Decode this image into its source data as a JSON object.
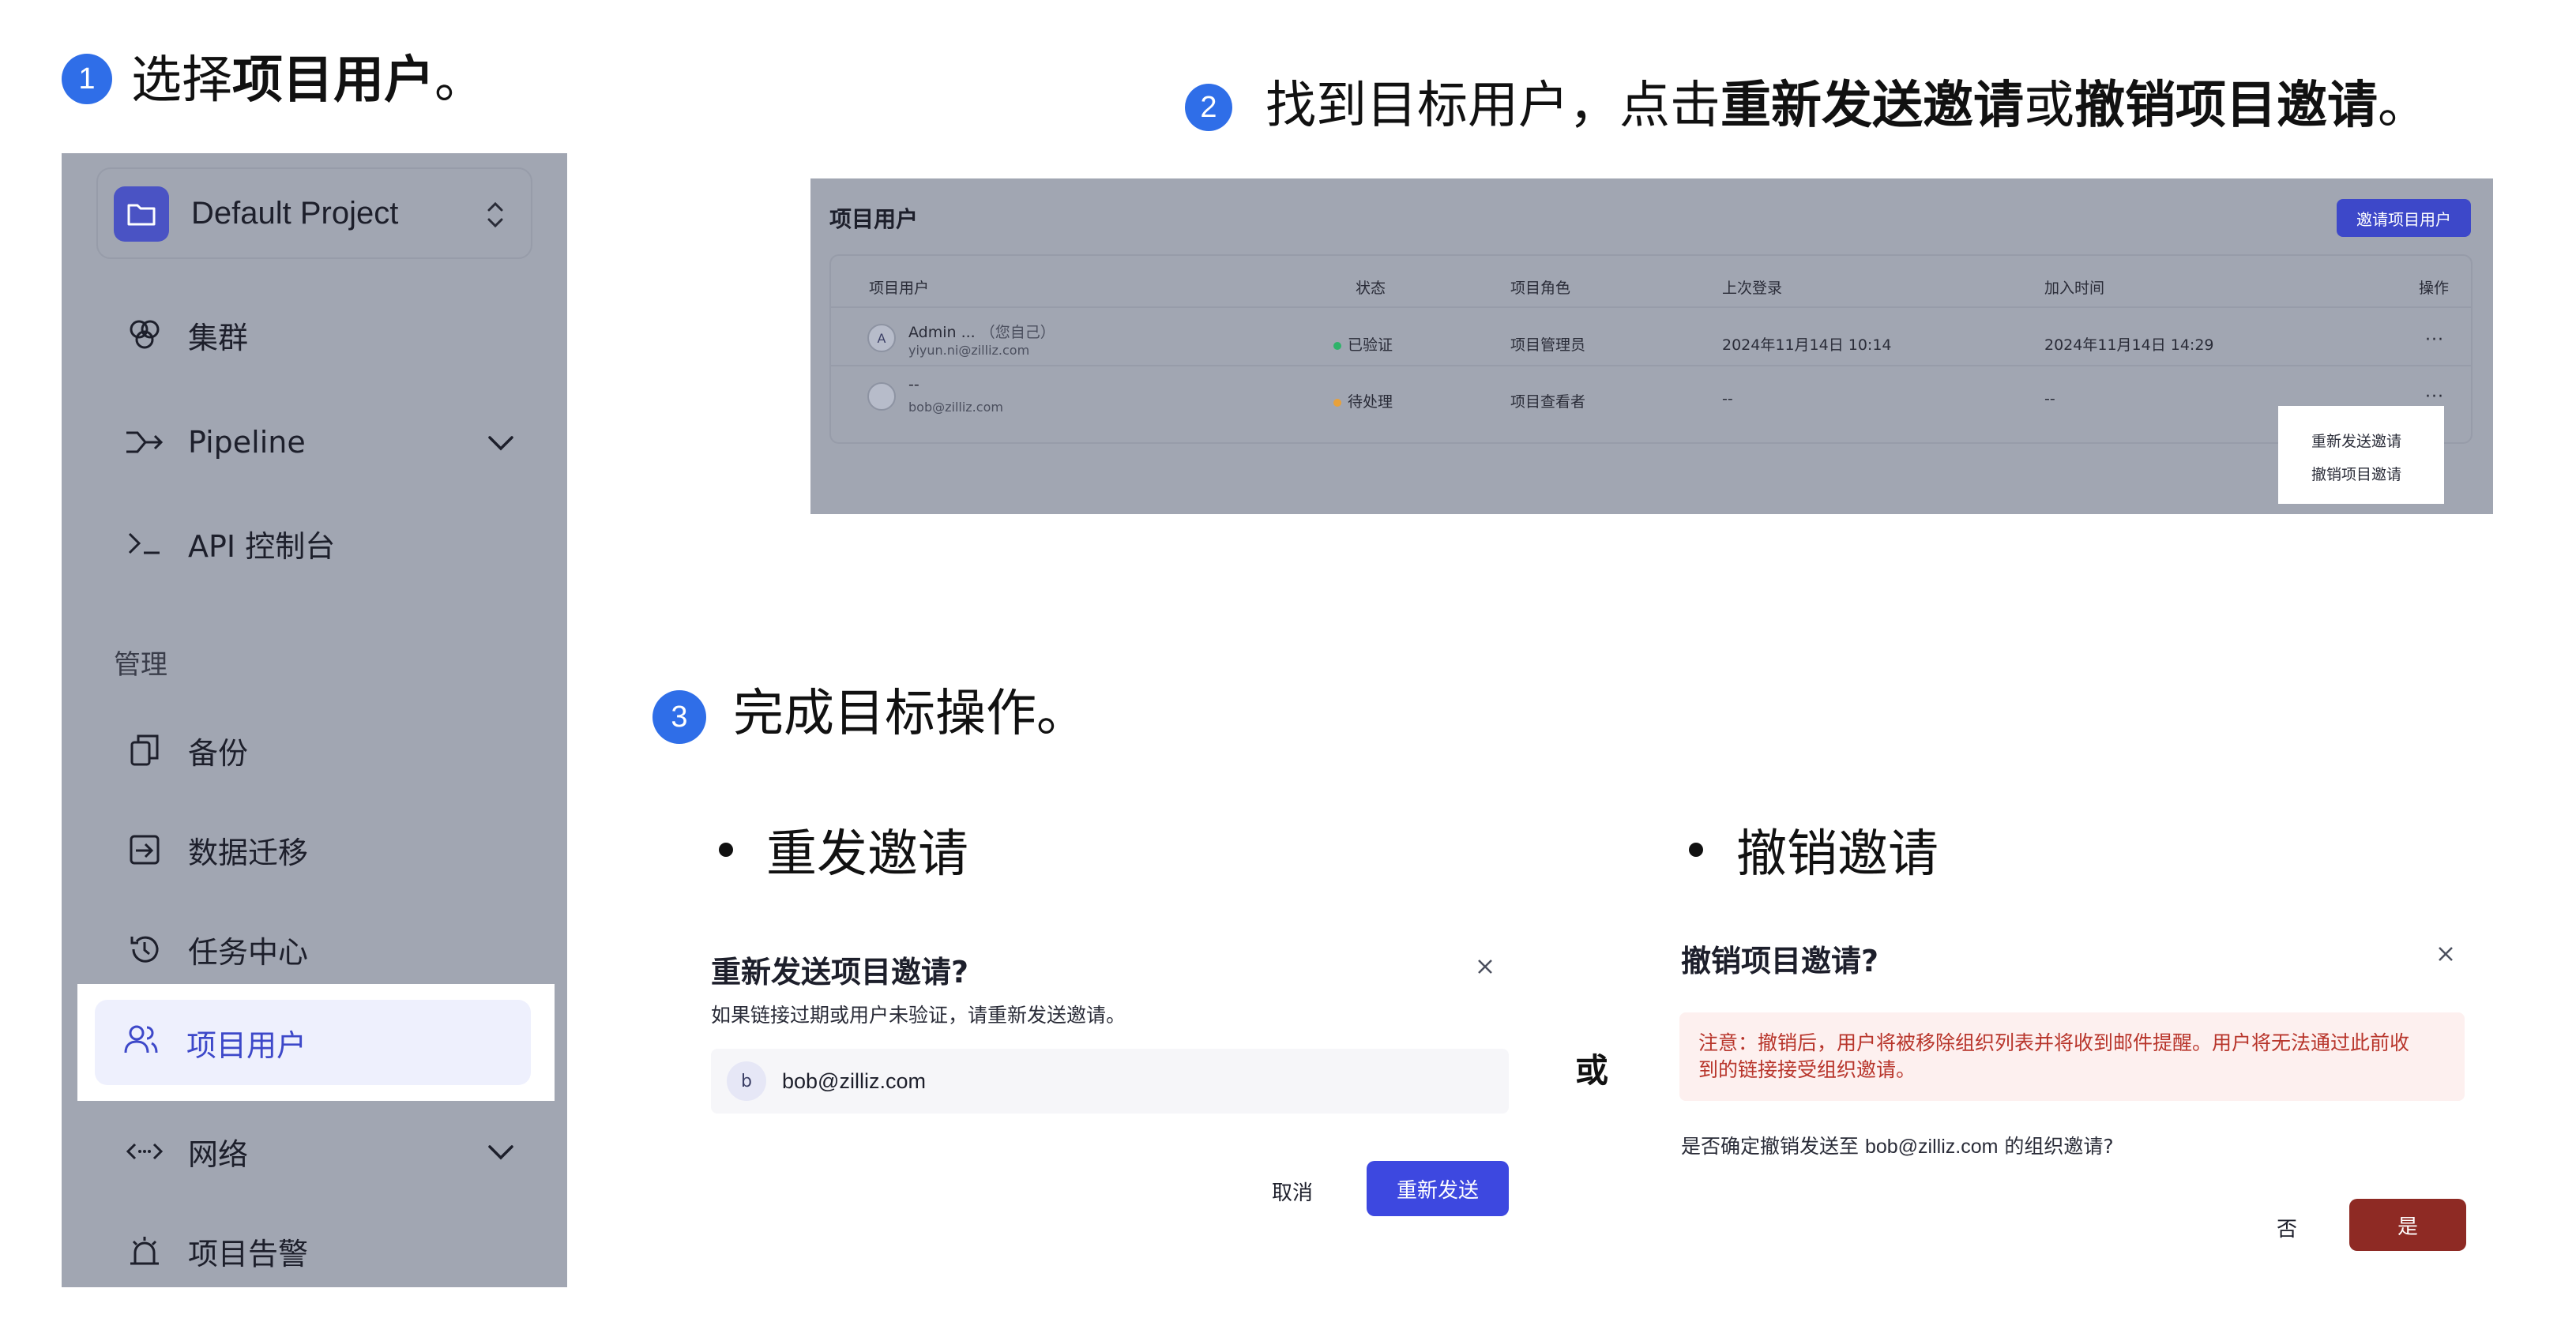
{
  "step1": {
    "num": "1",
    "prefix": "选择",
    "bold": "项目用户",
    "suffix": "。"
  },
  "step2": {
    "num": "2",
    "prefix": "找到目标用户，点击",
    "bold1": "重新发送邀请",
    "mid": "或",
    "bold2": "撤销项目邀请",
    "suffix": "。"
  },
  "step3": {
    "num": "3",
    "text": "完成目标操作。"
  },
  "sidebar": {
    "project": "Default Project",
    "items": [
      {
        "label": "集群",
        "icon": "cluster-icon"
      },
      {
        "label": "Pipeline",
        "icon": "pipeline-icon"
      },
      {
        "label": "API 控制台",
        "icon": "terminal-icon"
      }
    ],
    "section": "管理",
    "manage_items": [
      {
        "label": "备份",
        "icon": "backup-icon"
      },
      {
        "label": "数据迁移",
        "icon": "migration-icon"
      },
      {
        "label": "任务中心",
        "icon": "history-icon"
      },
      {
        "label": "项目用户",
        "icon": "users-icon",
        "active": true
      },
      {
        "label": "网络",
        "icon": "network-icon"
      },
      {
        "label": "项目告警",
        "icon": "alarm-icon"
      }
    ]
  },
  "users": {
    "title": "项目用户",
    "invite_button": "邀请项目用户",
    "columns": [
      "项目用户",
      "状态",
      "项目角色",
      "上次登录",
      "加入时间",
      "操作"
    ],
    "rows": [
      {
        "avatar": "A",
        "name": "Admin ...",
        "self": "（您自己）",
        "email": "yiyun.ni@zilliz.com",
        "status": "已验证",
        "status_color": "#2fb36a",
        "role": "项目管理员",
        "last_login": "2024年11月14日 10:14",
        "joined": "2024年11月14日 14:29",
        "ops": "···"
      },
      {
        "avatar": "",
        "name": "--",
        "self": "",
        "email": "bob@zilliz.com",
        "status": "待处理",
        "status_color": "#e8a13a",
        "role": "项目查看者",
        "last_login": "--",
        "joined": "--",
        "ops": "···"
      }
    ],
    "menu": [
      "重新发送邀请",
      "撤销项目邀请"
    ]
  },
  "resend": {
    "bullet": "重发邀请",
    "title": "重新发送项目邀请?",
    "desc": "如果链接过期或用户未验证，请重新发送邀请。",
    "avatar": "b",
    "email": "bob@zilliz.com",
    "cancel": "取消",
    "confirm": "重新发送"
  },
  "or": "或",
  "revoke": {
    "bullet": "撤销邀请",
    "title": "撤销项目邀请?",
    "warning_line1": "注意：撤销后，用户将被移除组织列表并将收到邮件提醒。用户将无法通过此前收",
    "warning_line2": "到的链接接受组织邀请。",
    "confirm_prefix": "是否确定撤销发送至 ",
    "confirm_email": "bob@zilliz.com",
    "confirm_suffix": " 的组织邀请?",
    "no": "否",
    "yes": "是"
  },
  "colors": {
    "accent": "#3d48e0",
    "step_badge": "#2f6ee8",
    "danger": "#8e2a24",
    "warning_text": "#b8352b"
  }
}
